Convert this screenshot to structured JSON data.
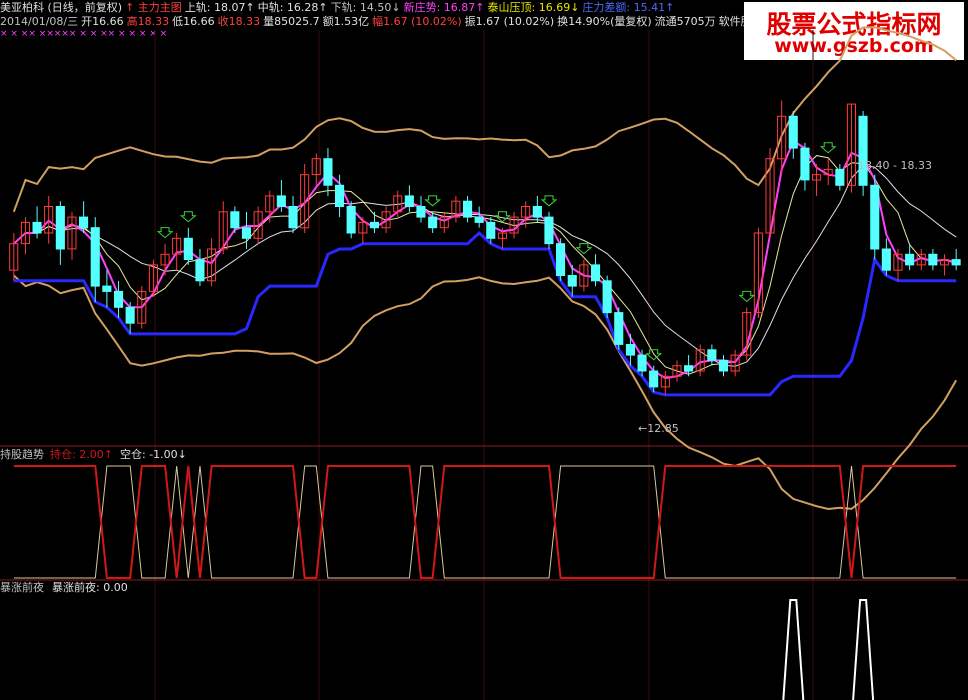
{
  "header": {
    "line1": [
      {
        "text": "美亚柏科 (日线，前复权)",
        "color": "white"
      },
      {
        "text": "↑ 主力主图",
        "color": "red"
      },
      {
        "text": "上轨: 18.07↑",
        "color": "white"
      },
      {
        "text": "中轨: 16.28↑",
        "color": "white"
      },
      {
        "text": "下轨: 14.50↓",
        "color": "gray"
      },
      {
        "text": "新庄势: 16.87↑",
        "color": "magenta"
      },
      {
        "text": "泰山压顶: 16.69↓",
        "color": "yellow"
      },
      {
        "text": "庄力差额: 15.41↑",
        "color": "blue"
      }
    ],
    "line2": [
      {
        "text": "2014/01/08/三",
        "color": "gray"
      },
      {
        "text": "开16.66",
        "color": "white"
      },
      {
        "text": "高18.33",
        "color": "red"
      },
      {
        "text": "低16.66",
        "color": "white"
      },
      {
        "text": "收18.33",
        "color": "red"
      },
      {
        "text": "量85025.7",
        "color": "white"
      },
      {
        "text": "额1.53亿",
        "color": "white"
      },
      {
        "text": "幅1.67 (10.02%)",
        "color": "red"
      },
      {
        "text": "振1.67 (10.02%)",
        "color": "white"
      },
      {
        "text": "换14.90%(量复权)",
        "color": "white"
      },
      {
        "text": "流通5705万",
        "color": "white"
      },
      {
        "text": "软件服务",
        "color": "white"
      }
    ],
    "marks": "×   ×            ××       ×××××    ×    ×    ××       ×   ×    ×    ×   ×"
  },
  "watermark": {
    "line1": "股票公式指标网",
    "line2": "www.gszb.com"
  },
  "main_annotations": {
    "high_label": "18.40 - 18.33",
    "low_label": "←12.85"
  },
  "panel2": {
    "title": "持股趋势",
    "hold_label": "持仓: 2.00↑",
    "empty_label": "空仓: -1.00↓"
  },
  "panel3": {
    "title": "暴涨前夜",
    "value_label": "暴涨前夜: 0.00"
  },
  "colors": {
    "up": "#ff3c3c",
    "down": "#54ffff",
    "mid": "#d2a060",
    "ma1": "#ff40ff",
    "ma2": "#e0e0e0",
    "ma3": "#e8e8a0",
    "support": "#2828ff",
    "hold": "#d01818",
    "empty": "#d8c8a0",
    "grid": "#8a1a1a"
  },
  "chart_data": {
    "type": "candlestick",
    "ylim": [
      12.0,
      19.5
    ],
    "candles": [
      [
        15.2,
        15.9,
        15.0,
        15.7
      ],
      [
        15.7,
        16.2,
        15.5,
        16.1
      ],
      [
        16.1,
        16.4,
        15.8,
        15.9
      ],
      [
        15.9,
        16.6,
        15.7,
        16.4
      ],
      [
        16.4,
        16.5,
        15.3,
        15.6
      ],
      [
        15.6,
        16.3,
        15.4,
        16.2
      ],
      [
        16.2,
        16.5,
        15.9,
        16.0
      ],
      [
        16.0,
        16.2,
        14.6,
        14.9
      ],
      [
        14.9,
        15.2,
        14.5,
        14.8
      ],
      [
        14.8,
        15.0,
        14.3,
        14.5
      ],
      [
        14.5,
        14.6,
        14.0,
        14.2
      ],
      [
        14.2,
        14.9,
        14.1,
        14.8
      ],
      [
        14.8,
        15.4,
        14.7,
        15.3
      ],
      [
        15.3,
        15.7,
        15.1,
        15.5
      ],
      [
        15.5,
        15.9,
        15.2,
        15.8
      ],
      [
        15.8,
        16.0,
        15.3,
        15.4
      ],
      [
        15.4,
        15.6,
        14.9,
        15.0
      ],
      [
        15.0,
        15.8,
        14.9,
        15.6
      ],
      [
        15.6,
        16.5,
        15.5,
        16.3
      ],
      [
        16.3,
        16.4,
        15.9,
        16.0
      ],
      [
        16.0,
        16.3,
        15.6,
        15.8
      ],
      [
        15.8,
        16.4,
        15.7,
        16.3
      ],
      [
        16.3,
        16.7,
        16.1,
        16.6
      ],
      [
        16.6,
        16.9,
        16.3,
        16.4
      ],
      [
        16.4,
        16.6,
        15.9,
        16.0
      ],
      [
        16.0,
        17.2,
        15.9,
        17.0
      ],
      [
        17.0,
        17.4,
        16.8,
        17.3
      ],
      [
        17.3,
        17.5,
        16.6,
        16.8
      ],
      [
        16.8,
        17.0,
        16.2,
        16.4
      ],
      [
        16.4,
        16.5,
        15.8,
        15.9
      ],
      [
        15.9,
        16.2,
        15.7,
        16.1
      ],
      [
        16.1,
        16.3,
        15.9,
        16.0
      ],
      [
        16.0,
        16.4,
        15.9,
        16.3
      ],
      [
        16.3,
        16.7,
        16.2,
        16.6
      ],
      [
        16.6,
        16.8,
        16.3,
        16.4
      ],
      [
        16.4,
        16.6,
        16.1,
        16.2
      ],
      [
        16.2,
        16.3,
        15.9,
        16.0
      ],
      [
        16.0,
        16.3,
        15.9,
        16.2
      ],
      [
        16.2,
        16.6,
        16.1,
        16.5
      ],
      [
        16.5,
        16.6,
        16.1,
        16.2
      ],
      [
        16.2,
        16.4,
        16.0,
        16.1
      ],
      [
        16.1,
        16.2,
        15.7,
        15.8
      ],
      [
        15.8,
        16.0,
        15.6,
        15.9
      ],
      [
        15.9,
        16.3,
        15.8,
        16.2
      ],
      [
        16.2,
        16.5,
        16.0,
        16.4
      ],
      [
        16.4,
        16.6,
        16.1,
        16.2
      ],
      [
        16.2,
        16.3,
        15.6,
        15.7
      ],
      [
        15.7,
        15.8,
        15.0,
        15.1
      ],
      [
        15.1,
        15.3,
        14.7,
        14.9
      ],
      [
        14.9,
        15.4,
        14.8,
        15.3
      ],
      [
        15.3,
        15.5,
        14.9,
        15.0
      ],
      [
        15.0,
        15.1,
        14.3,
        14.4
      ],
      [
        14.4,
        14.5,
        13.7,
        13.8
      ],
      [
        13.8,
        14.0,
        13.4,
        13.6
      ],
      [
        13.6,
        13.7,
        13.2,
        13.3
      ],
      [
        13.3,
        13.4,
        12.9,
        13.0
      ],
      [
        13.0,
        13.3,
        12.85,
        13.2
      ],
      [
        13.2,
        13.5,
        13.1,
        13.4
      ],
      [
        13.4,
        13.6,
        13.2,
        13.3
      ],
      [
        13.3,
        13.8,
        13.2,
        13.7
      ],
      [
        13.7,
        13.8,
        13.4,
        13.5
      ],
      [
        13.5,
        13.6,
        13.2,
        13.3
      ],
      [
        13.3,
        13.7,
        13.2,
        13.6
      ],
      [
        13.6,
        14.5,
        13.5,
        14.4
      ],
      [
        14.4,
        16.0,
        14.3,
        15.9
      ],
      [
        15.9,
        17.5,
        15.8,
        17.3
      ],
      [
        17.3,
        18.4,
        17.0,
        18.1
      ],
      [
        18.1,
        18.2,
        17.3,
        17.5
      ],
      [
        17.5,
        17.6,
        16.7,
        16.9
      ],
      [
        16.9,
        17.2,
        16.6,
        17.0
      ],
      [
        17.0,
        17.3,
        16.8,
        17.1
      ],
      [
        17.1,
        17.2,
        16.7,
        16.8
      ],
      [
        16.8,
        18.33,
        16.66,
        18.33
      ],
      [
        18.1,
        18.2,
        16.6,
        16.8
      ],
      [
        16.8,
        17.0,
        15.4,
        15.6
      ],
      [
        15.6,
        15.8,
        15.1,
        15.2
      ],
      [
        15.2,
        15.6,
        15.0,
        15.5
      ],
      [
        15.5,
        15.7,
        15.2,
        15.3
      ],
      [
        15.3,
        15.6,
        15.2,
        15.5
      ],
      [
        15.5,
        15.6,
        15.2,
        15.3
      ],
      [
        15.3,
        15.5,
        15.1,
        15.4
      ],
      [
        15.4,
        15.6,
        15.2,
        15.3
      ]
    ],
    "hold_states": [
      1,
      1,
      1,
      1,
      1,
      1,
      1,
      1,
      0,
      0,
      0,
      1,
      1,
      1,
      0,
      1,
      0,
      1,
      1,
      1,
      1,
      1,
      1,
      1,
      1,
      0,
      0,
      1,
      1,
      1,
      1,
      1,
      1,
      1,
      1,
      0,
      0,
      1,
      1,
      1,
      1,
      1,
      1,
      1,
      1,
      1,
      1,
      0,
      0,
      0,
      0,
      0,
      0,
      0,
      0,
      0,
      1,
      1,
      1,
      1,
      1,
      1,
      1,
      1,
      1,
      1,
      1,
      1,
      1,
      1,
      1,
      1,
      0,
      1,
      1,
      1,
      1,
      1,
      1,
      1,
      1,
      1
    ],
    "surge_pulses": [
      67,
      73
    ]
  }
}
